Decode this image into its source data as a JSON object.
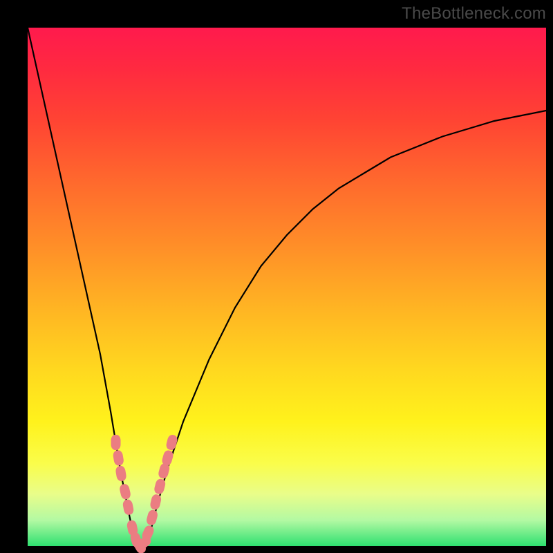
{
  "watermark": "TheBottleneck.com",
  "colors": {
    "frame": "#000000",
    "curve": "#000000",
    "marker": "#eb7d82",
    "gradient_top": "#ff1a4d",
    "gradient_bottom": "#2ee070"
  },
  "chart_data": {
    "type": "line",
    "title": "",
    "xlabel": "",
    "ylabel": "",
    "xlim": [
      0,
      100
    ],
    "ylim": [
      0,
      100
    ],
    "annotations": [
      "TheBottleneck.com"
    ],
    "series": [
      {
        "name": "bottleneck-curve",
        "x": [
          0,
          2,
          4,
          6,
          8,
          10,
          12,
          14,
          16,
          17,
          18,
          19,
          20,
          21,
          22,
          23,
          24,
          25,
          27,
          30,
          35,
          40,
          45,
          50,
          55,
          60,
          65,
          70,
          75,
          80,
          85,
          90,
          95,
          100
        ],
        "y": [
          100,
          91,
          82,
          73,
          64,
          55,
          46,
          37,
          26,
          20,
          14,
          9,
          4,
          1,
          0,
          1,
          4,
          8,
          15,
          24,
          36,
          46,
          54,
          60,
          65,
          69,
          72,
          75,
          77,
          79,
          80.5,
          82,
          83,
          84
        ]
      }
    ],
    "markers": {
      "name": "highlight-points",
      "x": [
        17.0,
        17.5,
        18.0,
        18.8,
        19.4,
        20.2,
        20.9,
        21.6,
        22.4,
        23.2,
        24.0,
        24.7,
        25.5,
        26.3,
        27.0,
        27.8
      ],
      "y": [
        20.0,
        17.0,
        14.0,
        10.5,
        7.5,
        3.5,
        1.2,
        0.0,
        0.6,
        2.5,
        5.5,
        8.5,
        11.5,
        14.5,
        17.0,
        20.0
      ]
    }
  }
}
